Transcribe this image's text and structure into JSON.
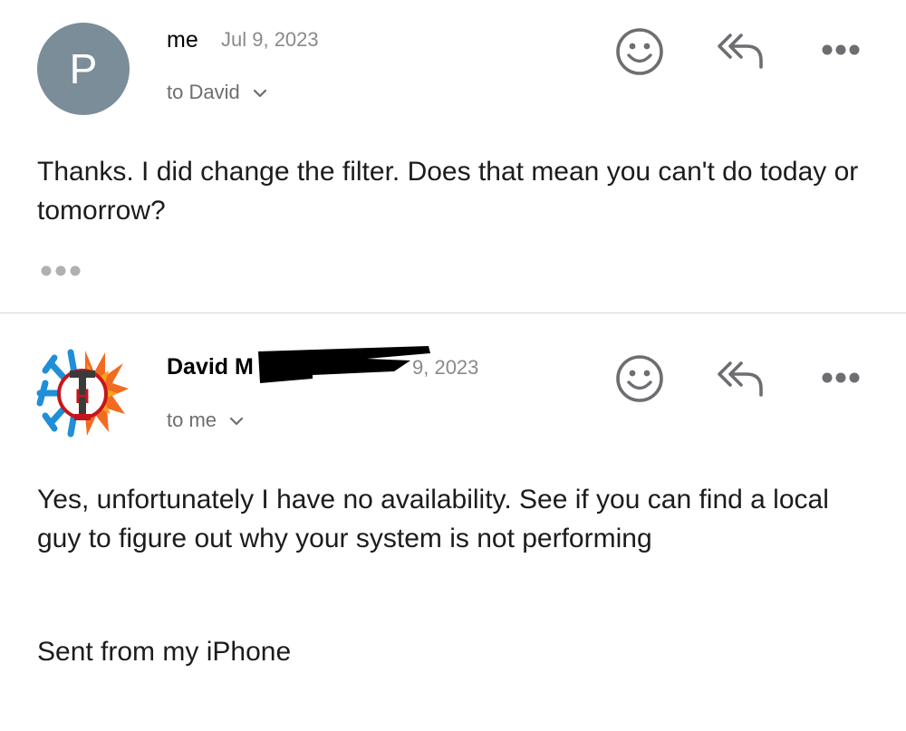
{
  "messages": [
    {
      "avatar": {
        "type": "initial",
        "letter": "P",
        "color": "#7b8d99"
      },
      "sender": "me",
      "date": "Jul 9, 2023",
      "recipient": "to David",
      "body": "Thanks. I did change the filter. Does that mean you can't do today or tomorrow?",
      "collapsed_quote_icon": "more-horizontal-icon"
    },
    {
      "avatar": {
        "type": "logo",
        "icon": "heating-cooling-logo-icon"
      },
      "sender": "David M",
      "date": "9, 2023",
      "recipient": "to me",
      "body": "Yes, unfortunately I have no availability. See if you can find a local guy to figure out why your system is not performing",
      "signature": "Sent from my iPhone"
    }
  ],
  "actions": {
    "reaction_icon": "smiley-icon",
    "reply_all_icon": "reply-all-icon",
    "more_icon": "more-horizontal-icon"
  },
  "colors": {
    "icon": "#6d6d72",
    "date": "#8a8a8e",
    "divider": "#d8d8dc",
    "redaction": "#000000"
  }
}
